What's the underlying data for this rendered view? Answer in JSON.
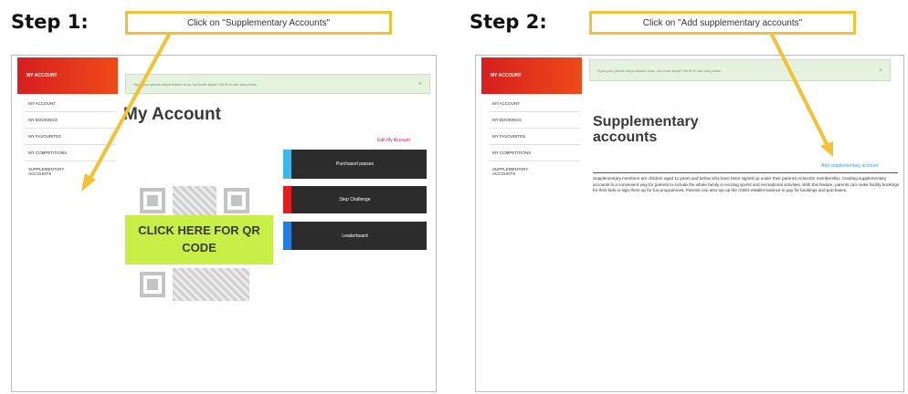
{
  "steps": [
    {
      "title": "Step 1:",
      "instruction": "Click on \"Supplementary Accounts\"",
      "screen": {
        "my_account_tab": "MY ACCOUNT",
        "notice": "Sync your phone steps tracker now, not more steps? Be fit to see and prizes",
        "notice_close": "×",
        "page_title": "My Account",
        "edit_link": "Edit My Account",
        "sidebar": [
          "MY ACCOUNT",
          "MY BOOKINGS",
          "MY FAVOURITES",
          "MY COMPETITIONS",
          "SUPPLEMENTARY ACCOUNTS"
        ],
        "buttons": [
          {
            "label": "Purchased passes",
            "color": "#3fb6e8"
          },
          {
            "label": "Step Challenge",
            "color": "#e51b1b"
          },
          {
            "label": "Leaderboard",
            "color": "#1f7fe0"
          }
        ],
        "qr_button": "CLICK HERE FOR QR CODE"
      }
    },
    {
      "title": "Step 2:",
      "instruction": "Click on \"Add supplementary accounts\"",
      "screen": {
        "my_account_tab": "MY ACCOUNT",
        "notice": "Sync your phone steps tracker now, not more steps? Be fit to see and prizes",
        "notice_close": "×",
        "sidebar": [
          "MY ACCOUNT",
          "MY BOOKINGS",
          "MY FAVOURITES",
          "MY COMPETITIONS",
          "SUPPLEMENTARY ACCOUNTS"
        ],
        "page_title_line1": "Supplementary",
        "page_title_line2": "accounts",
        "add_link": "Add supplementary account",
        "description": "Supplementary members are children aged 11 years and below who have been signed up under their parent's ActiveSG membership. Creating supplementary accounts is a convenient way for parents to include the whole family in exciting sports and recreational activities. With this feature, parents can make facility bookings for their kids or sign them up for fun programmes. Parents can also top up the child's eWallet balance to pay for bookings and purchases."
      }
    }
  ],
  "colors": {
    "callout_border": "#f2c230",
    "arrow": "#f2c230",
    "accent_red": "#d61f1f",
    "qr_button": "#c7ef45",
    "divider_red": "#c62828"
  }
}
